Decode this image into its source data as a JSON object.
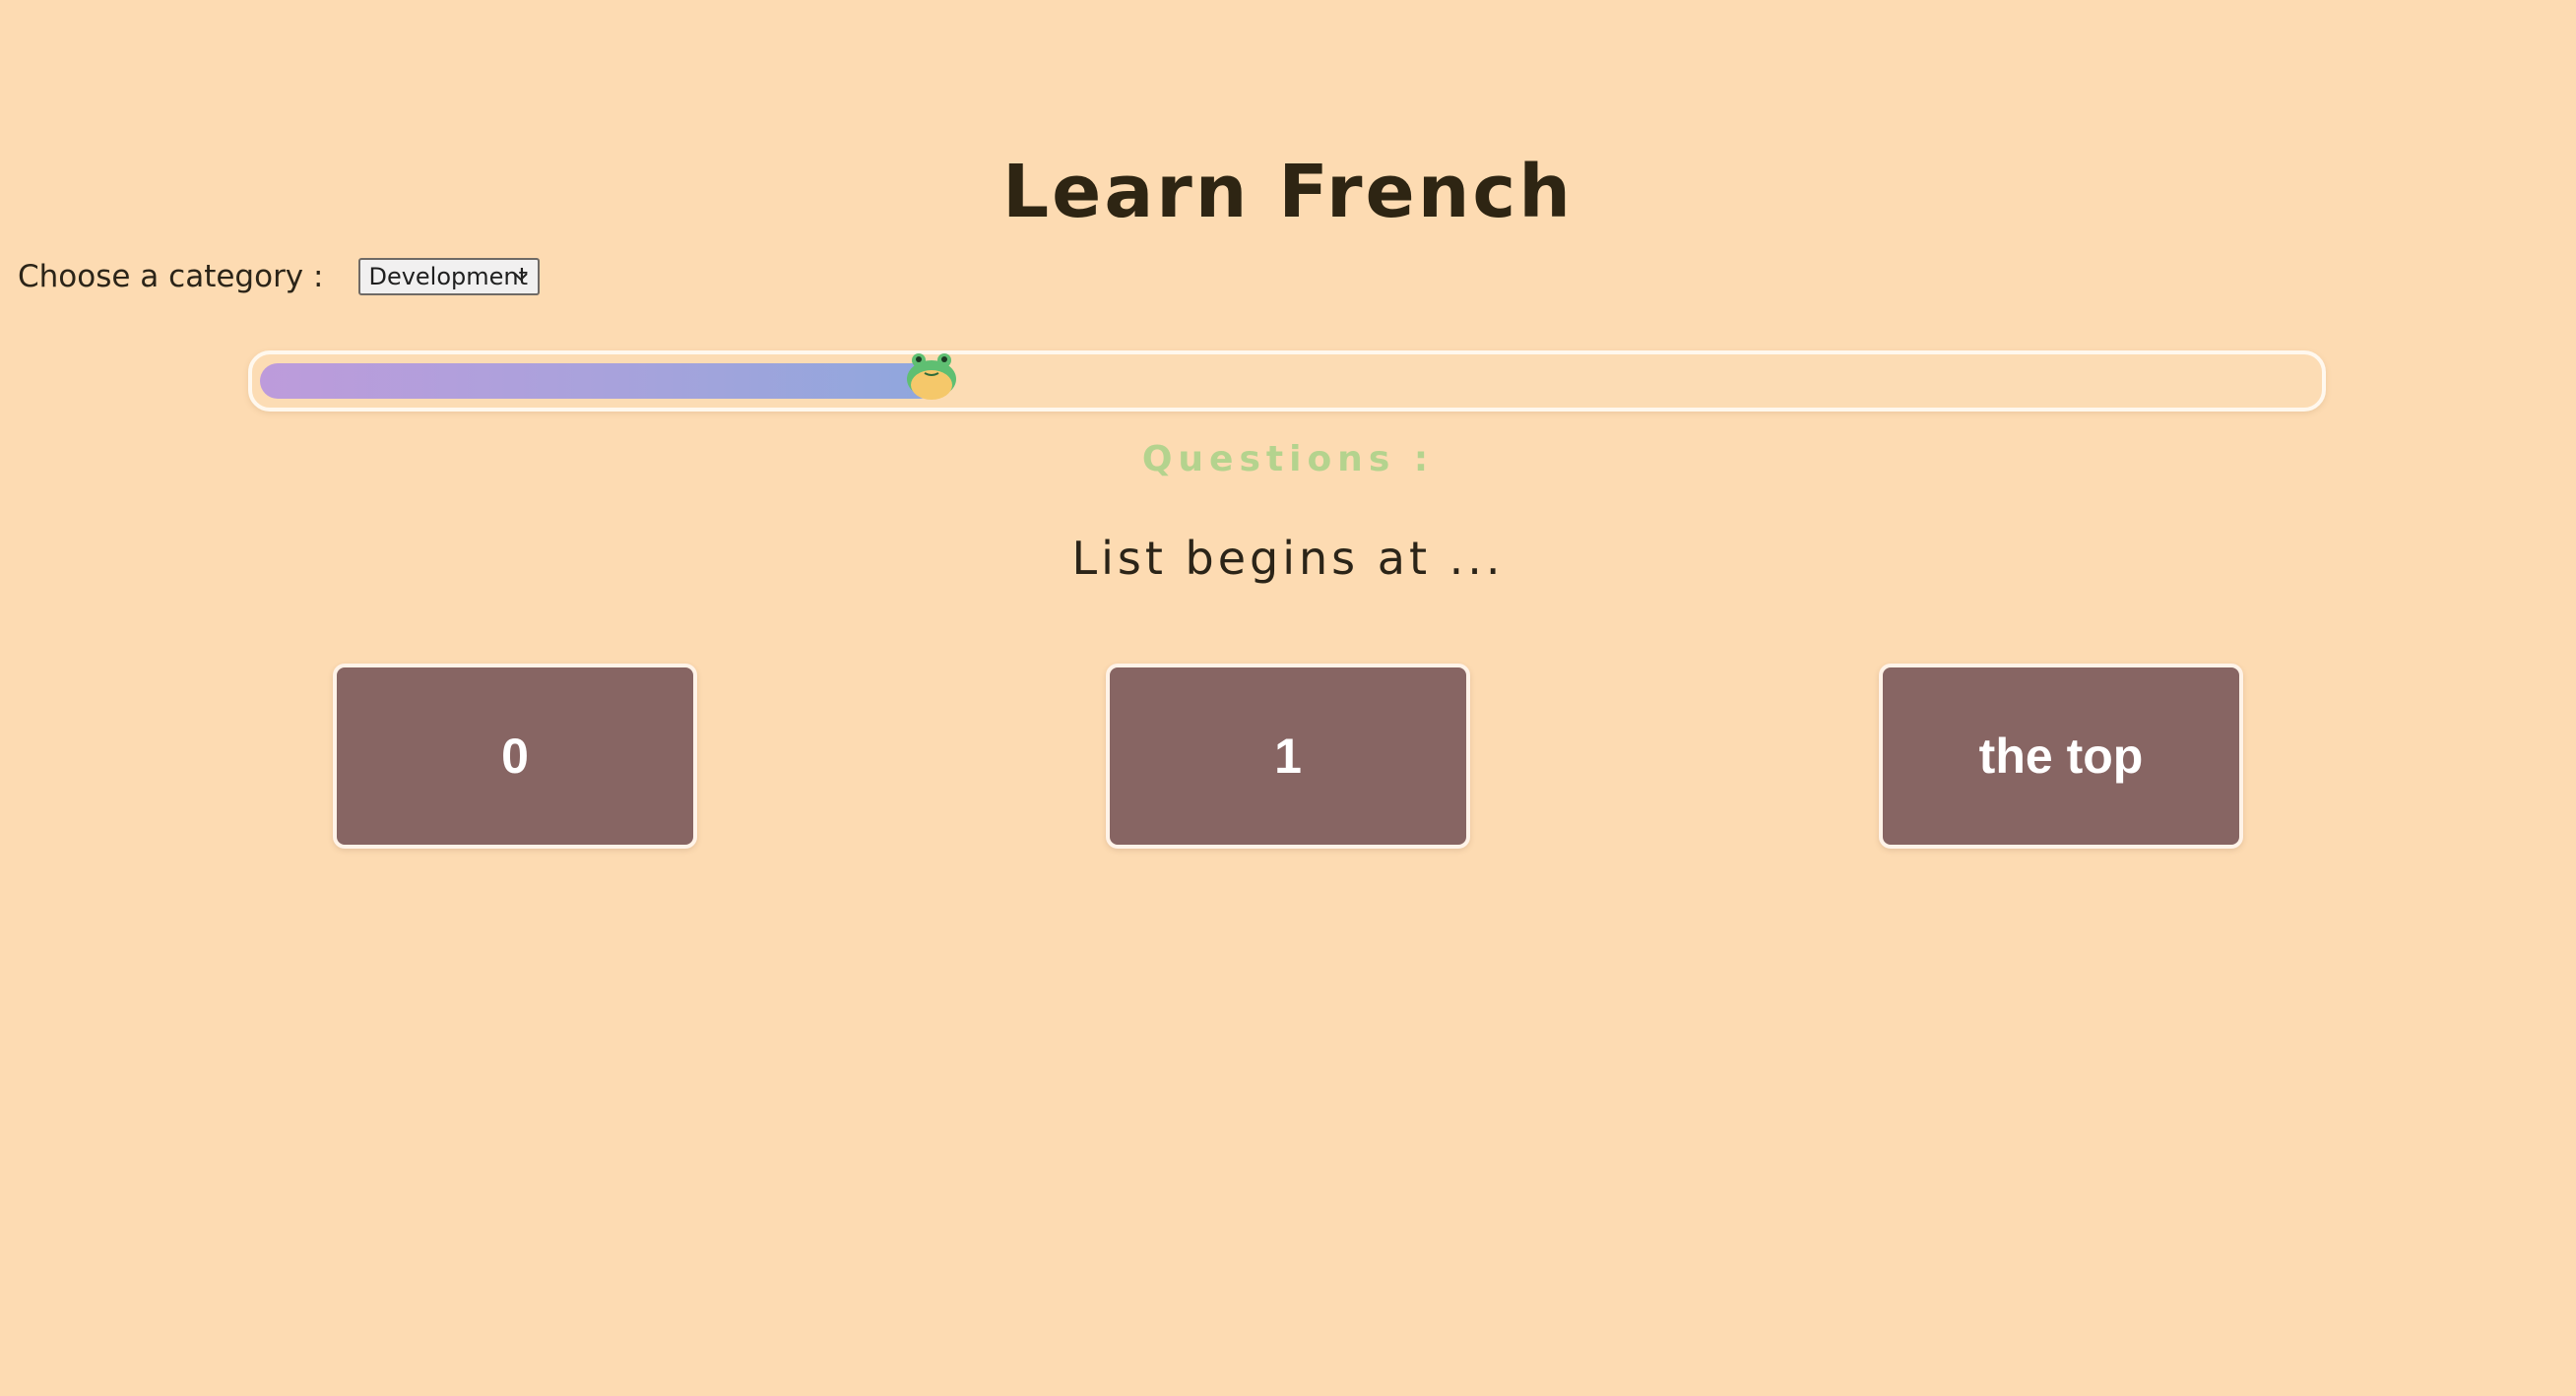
{
  "header": {
    "title": "Learn French"
  },
  "category": {
    "label": "Choose a category :",
    "selected": "Development"
  },
  "progress": {
    "fraction": 0.33
  },
  "quiz": {
    "section_label": "Questions :",
    "question": "List begins at ...",
    "answers": [
      {
        "label": "0"
      },
      {
        "label": "1"
      },
      {
        "label": "the top"
      }
    ]
  },
  "icons": {
    "progress_marker": "frog-icon",
    "select_arrow": "chevron-down-icon"
  },
  "colors": {
    "background": "#fddbb2",
    "answer_button": "#876563",
    "questions_label": "#b4d38e",
    "progress_start": "#bd9bdb",
    "progress_end": "#8fa7dd"
  }
}
